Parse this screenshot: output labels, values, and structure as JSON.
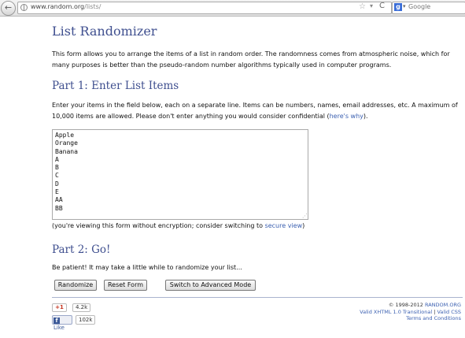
{
  "browser": {
    "back_glyph": "←",
    "url_host": "www.random.org",
    "url_path": "/lists/",
    "star_glyph": "☆",
    "dropdown_glyph": "▾",
    "reload_glyph": "C",
    "search_engine_glyph": "g",
    "search_engine_dropdown_glyph": "▾",
    "search_placeholder": "Google"
  },
  "page": {
    "title": "List Randomizer",
    "intro": "This form allows you to arrange the items of a list in random order. The randomness comes from atmospheric noise, which for many purposes is better than the pseudo-random number algorithms typically used in computer programs."
  },
  "part1": {
    "heading": "Part 1: Enter List Items",
    "instructions_before_link": "Enter your items in the field below, each on a separate line. Items can be numbers, names, email addresses, etc. A maximum of 10,000 items are allowed. Please don't enter anything you would consider confidential (",
    "link_text": "here's why",
    "instructions_after_link": ").",
    "list_value": "Apple\nOrange\nBanana\nA\nB\nC\nD\nE\nAA\nBB",
    "resize_glyph": "⋰",
    "encryption_note_before": "(you're viewing this form without encryption; consider switching to ",
    "secure_link_text": "secure view",
    "encryption_note_after": ")"
  },
  "part2": {
    "heading": "Part 2: Go!",
    "patience_text": "Be patient! It may take a little while to randomize your list...",
    "randomize_label": "Randomize",
    "reset_label": "Reset Form",
    "advanced_label": "Switch to Advanced Mode"
  },
  "footer": {
    "gplus_label": "+1",
    "gplus_count": "4.2k",
    "fb_icon_glyph": "f",
    "fb_like_label": "Like",
    "fb_count": "102k",
    "copyright_prefix": "© 1998-2012 ",
    "copyright_link": "RANDOM.ORG",
    "valid_xhtml": "Valid XHTML 1.0 Transitional",
    "separator": " | ",
    "valid_css": "Valid CSS",
    "terms": "Terms and Conditions"
  },
  "colors": {
    "heading": "#3f4f8f",
    "link": "#3a5fb0",
    "rule": "#a9b4cf"
  }
}
